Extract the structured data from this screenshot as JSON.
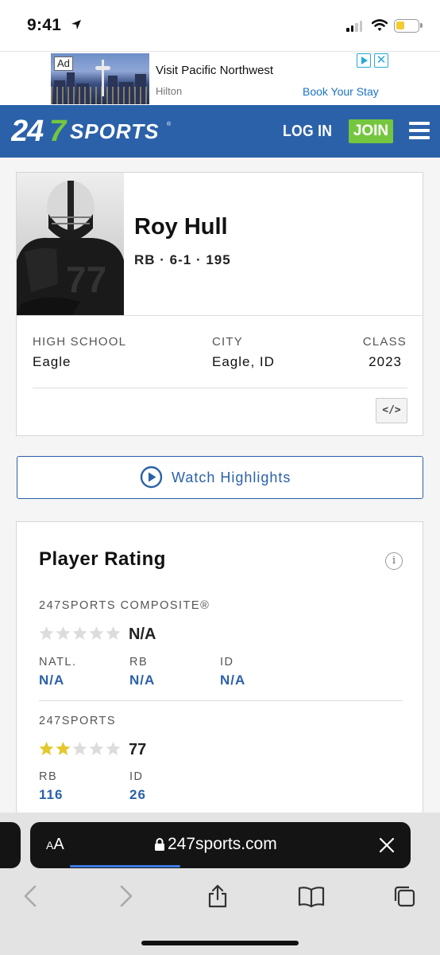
{
  "status_bar": {
    "time": "9:41"
  },
  "ad": {
    "badge": "Ad",
    "title": "Visit Pacific Northwest",
    "sponsor": "Hilton",
    "cta": "Book Your Stay"
  },
  "header": {
    "logo_text": "247SPORTS",
    "login_label": "LOG IN",
    "join_label": "JOIN"
  },
  "player": {
    "name": "Roy Hull",
    "meta": "RB · 6-1 · 195",
    "info": [
      {
        "label": "HIGH SCHOOL",
        "value": "Eagle"
      },
      {
        "label": "CITY",
        "value": "Eagle, ID"
      },
      {
        "label": "CLASS",
        "value": "2023"
      }
    ],
    "embed_label": "</>"
  },
  "highlights": {
    "label": "Watch Highlights"
  },
  "rating": {
    "title": "Player Rating",
    "composite": {
      "label": "247SPORTS COMPOSITE®",
      "stars": 0,
      "score": "N/A",
      "ranks": [
        {
          "label": "NATL.",
          "value": "N/A"
        },
        {
          "label": "RB",
          "value": "N/A"
        },
        {
          "label": "ID",
          "value": "N/A"
        }
      ]
    },
    "sports247": {
      "label": "247SPORTS",
      "stars": 2,
      "score": "77",
      "ranks": [
        {
          "label": "RB",
          "value": "116"
        },
        {
          "label": "ID",
          "value": "26"
        }
      ]
    }
  },
  "browser": {
    "aa_label": "AA",
    "url": "247sports.com"
  },
  "colors": {
    "brand_blue": "#2b61a9",
    "join_green": "#75c63f",
    "star_gold": "#e5c82b",
    "star_empty": "#dcdcdc"
  }
}
